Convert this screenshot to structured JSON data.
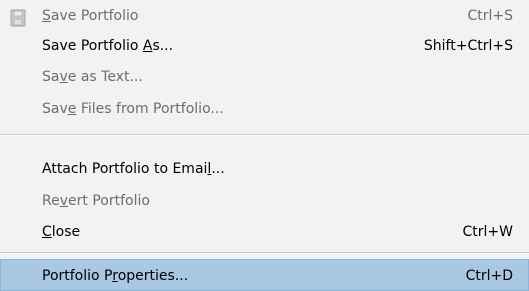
{
  "menu": {
    "items": [
      {
        "label_before": "",
        "mnemonic": "S",
        "label_after": "ave Portfolio",
        "shortcut": "Ctrl+S",
        "enabled": false,
        "icon": "save-disk-icon"
      },
      {
        "label_before": "Save Portfolio ",
        "mnemonic": "A",
        "label_after": "s...",
        "shortcut": "Shift+Ctrl+S",
        "enabled": true
      },
      {
        "label_before": "Sa",
        "mnemonic": "v",
        "label_after": "e as Text...",
        "shortcut": "",
        "enabled": false
      },
      {
        "label_before": "Sav",
        "mnemonic": "e",
        "label_after": " Files from Portfolio...",
        "shortcut": "",
        "enabled": false
      },
      {
        "label_before": "Attach Portfolio to Emai",
        "mnemonic": "l",
        "label_after": "...",
        "shortcut": "",
        "enabled": true
      },
      {
        "label_before": "Re",
        "mnemonic": "v",
        "label_after": "ert Portfolio",
        "shortcut": "",
        "enabled": false
      },
      {
        "label_before": "",
        "mnemonic": "C",
        "label_after": "lose",
        "shortcut": "Ctrl+W",
        "enabled": true
      },
      {
        "label_before": "Portfolio P",
        "mnemonic": "r",
        "label_after": "operties...",
        "shortcut": "Ctrl+D",
        "enabled": true,
        "highlighted": true
      }
    ],
    "colors": {
      "background": "#f2f2f2",
      "disabled_text": "#6d6d6d",
      "highlight": "#a9c8e3"
    }
  }
}
